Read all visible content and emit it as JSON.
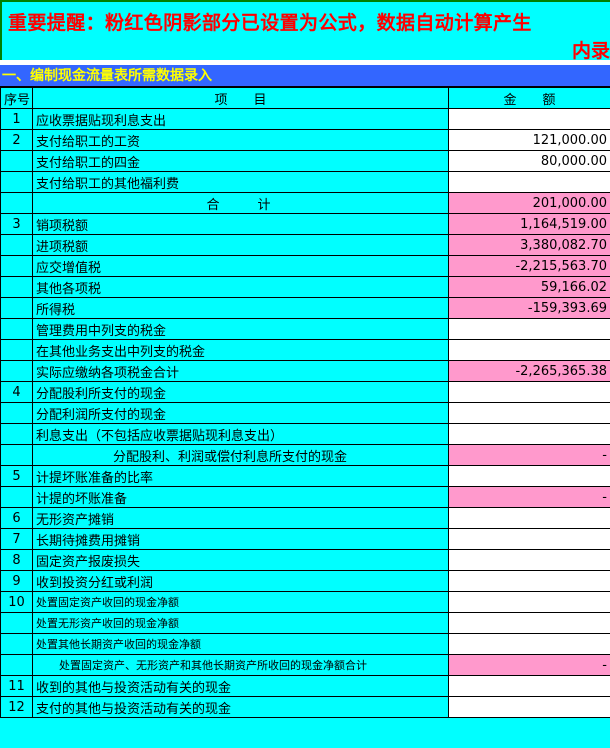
{
  "banner": {
    "line1": "重要提醒：粉红色阴影部分已设置为公式，数据自动计算产生",
    "line2": "内录"
  },
  "section_title": "一、编制现金流量表所需数据录入",
  "table": {
    "headers": {
      "seq": "序号",
      "item": "项　　目",
      "amount": "金　　额"
    },
    "rows": [
      {
        "seq": "1",
        "item": "应收票据贴现利息支出",
        "amount": ""
      },
      {
        "seq": "2",
        "item": "支付给职工的工资",
        "amount": "121,000.00"
      },
      {
        "seq": "",
        "item": "支付给职工的四金",
        "amount": "80,000.00"
      },
      {
        "seq": "",
        "item": "支付给职工的其他福利费",
        "amount": ""
      },
      {
        "seq": "",
        "item": "合　　计",
        "amount": "201,000.00"
      },
      {
        "seq": "3",
        "item": "销项税额",
        "amount": "1,164,519.00"
      },
      {
        "seq": "",
        "item": "进项税额",
        "amount": "3,380,082.70"
      },
      {
        "seq": "",
        "item": "应交增值税",
        "amount": "-2,215,563.70"
      },
      {
        "seq": "",
        "item": "其他各项税",
        "amount": "59,166.02"
      },
      {
        "seq": "",
        "item": "所得税",
        "amount": "-159,393.69"
      },
      {
        "seq": "",
        "item": "管理费用中列支的税金",
        "amount": ""
      },
      {
        "seq": "",
        "item": "在其他业务支出中列支的税金",
        "amount": ""
      },
      {
        "seq": "",
        "item": "实际应缴纳各项税金合计",
        "amount": "-2,265,365.38"
      },
      {
        "seq": "4",
        "item": "分配股利所支付的现金",
        "amount": ""
      },
      {
        "seq": "",
        "item": "分配利润所支付的现金",
        "amount": ""
      },
      {
        "seq": "",
        "item": "利息支出（不包括应收票据贴现利息支出）",
        "amount": ""
      },
      {
        "seq": "",
        "item": "分配股利、利润或偿付利息所支付的现金",
        "amount": "-"
      },
      {
        "seq": "5",
        "item": "计提坏账准备的比率",
        "amount": ""
      },
      {
        "seq": "",
        "item": "计提的坏账准备",
        "amount": "-"
      },
      {
        "seq": "6",
        "item": "无形资产摊销",
        "amount": ""
      },
      {
        "seq": "7",
        "item": "长期待摊费用摊销",
        "amount": ""
      },
      {
        "seq": "8",
        "item": "固定资产报废损失",
        "amount": ""
      },
      {
        "seq": "9",
        "item": "收到投资分红或利润",
        "amount": ""
      },
      {
        "seq": "10",
        "item": "处置固定资产收回的现金净额",
        "amount": ""
      },
      {
        "seq": "",
        "item": "处置无形资产收回的现金净额",
        "amount": ""
      },
      {
        "seq": "",
        "item": "处置其他长期资产收回的现金净额",
        "amount": ""
      },
      {
        "seq": "",
        "item": "处置固定资产、无形资产和其他长期资产所收回的现金净额合计",
        "amount": "-"
      },
      {
        "seq": "11",
        "item": "收到的其他与投资活动有关的现金",
        "amount": ""
      },
      {
        "seq": "12",
        "item": "支付的其他与投资活动有关的现金",
        "amount": ""
      }
    ]
  },
  "colors": {
    "background": "#00ffff",
    "formula_cell": "#ff99cc",
    "input_cell": "#ffffff",
    "section_bar": "#3366ff",
    "section_text": "#ffff00",
    "banner_text": "#ff0000"
  }
}
